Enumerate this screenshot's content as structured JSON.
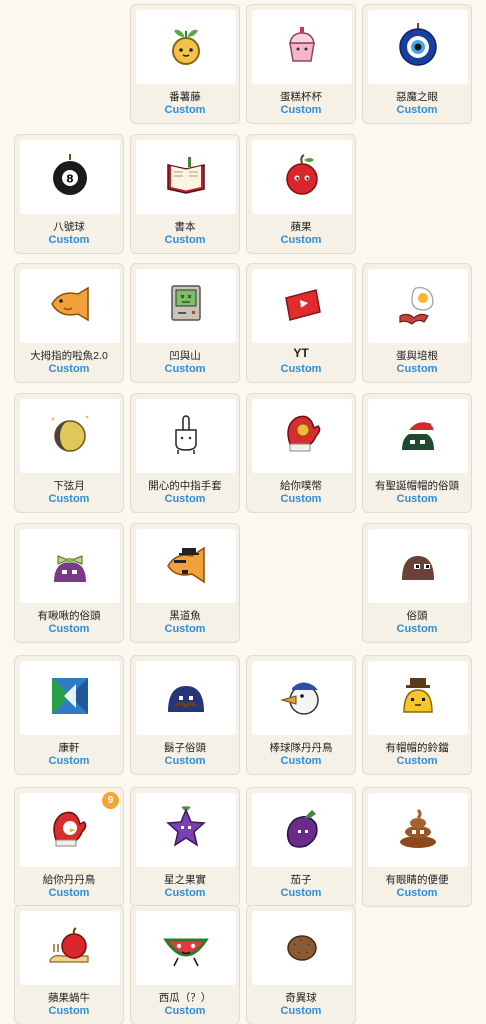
{
  "items": [
    {
      "name": "",
      "sub": "",
      "icon": "none",
      "blank": true
    },
    {
      "name": "番薯藤",
      "sub": "Custom",
      "icon": "sweet-potato-sprout-icon"
    },
    {
      "name": "蛋糕杯杯",
      "sub": "Custom",
      "icon": "cupcake-icon"
    },
    {
      "name": "惡魔之眼",
      "sub": "Custom",
      "icon": "evil-eye-icon"
    },
    {
      "name": "八號球",
      "sub": "Custom",
      "icon": "eight-ball-icon"
    },
    {
      "name": "書本",
      "sub": "Custom",
      "icon": "book-icon"
    },
    {
      "name": "蘋果",
      "sub": "Custom",
      "icon": "apple-icon"
    },
    {
      "name": "",
      "sub": "",
      "icon": "none",
      "blank": true
    },
    {
      "name": "大拇指的啦魚2.0",
      "sub": "Custom",
      "icon": "taiyaki-fish-icon"
    },
    {
      "name": "凹與山",
      "sub": "Custom",
      "icon": "retro-computer-icon"
    },
    {
      "name": "YT",
      "sub": "Custom",
      "icon": "youtube-play-icon",
      "bold": true
    },
    {
      "name": "蛋與培根",
      "sub": "Custom",
      "icon": "egg-bacon-icon"
    },
    {
      "name": "下弦月",
      "sub": "Custom",
      "icon": "moon-icon"
    },
    {
      "name": "開心的中指手套",
      "sub": "Custom",
      "icon": "glove-hand-icon"
    },
    {
      "name": "給你噗幣",
      "sub": "Custom",
      "icon": "mitten-coin-icon"
    },
    {
      "name": "有聖誕帽帽的俗頭",
      "sub": "Custom",
      "icon": "santa-blob-icon"
    },
    {
      "name": "有啾啾的俗頭",
      "sub": "Custom",
      "icon": "bow-blob-icon"
    },
    {
      "name": "黑道魚",
      "sub": "Custom",
      "icon": "gangster-fish-icon"
    },
    {
      "name": "",
      "sub": "",
      "icon": "none",
      "blank": true
    },
    {
      "name": "俗頭",
      "sub": "Custom",
      "icon": "brown-blob-icon"
    },
    {
      "name": "康軒",
      "sub": "Custom",
      "icon": "kangxuan-logo-icon"
    },
    {
      "name": "鬍子俗頭",
      "sub": "Custom",
      "icon": "mustache-blob-icon"
    },
    {
      "name": "棒球隊丹丹鳥",
      "sub": "Custom",
      "icon": "baseball-bird-icon"
    },
    {
      "name": "有帽帽的鈴鐺",
      "sub": "Custom",
      "icon": "hat-bell-icon"
    },
    {
      "name": "給你丹丹鳥",
      "sub": "Custom",
      "icon": "mitten-bird-icon",
      "badge": "9"
    },
    {
      "name": "星之果實",
      "sub": "Custom",
      "icon": "star-fruit-icon"
    },
    {
      "name": "茄子",
      "sub": "Custom",
      "icon": "eggplant-icon"
    },
    {
      "name": "有眼睛的便便",
      "sub": "Custom",
      "icon": "poop-icon"
    },
    {
      "name": "蘋果蝸牛",
      "sub": "Custom",
      "icon": "apple-snail-icon"
    },
    {
      "name": "西瓜（？）",
      "sub": "Custom",
      "icon": "watermelon-icon"
    },
    {
      "name": "奇異球",
      "sub": "Custom",
      "icon": "kiwi-ball-icon"
    }
  ]
}
